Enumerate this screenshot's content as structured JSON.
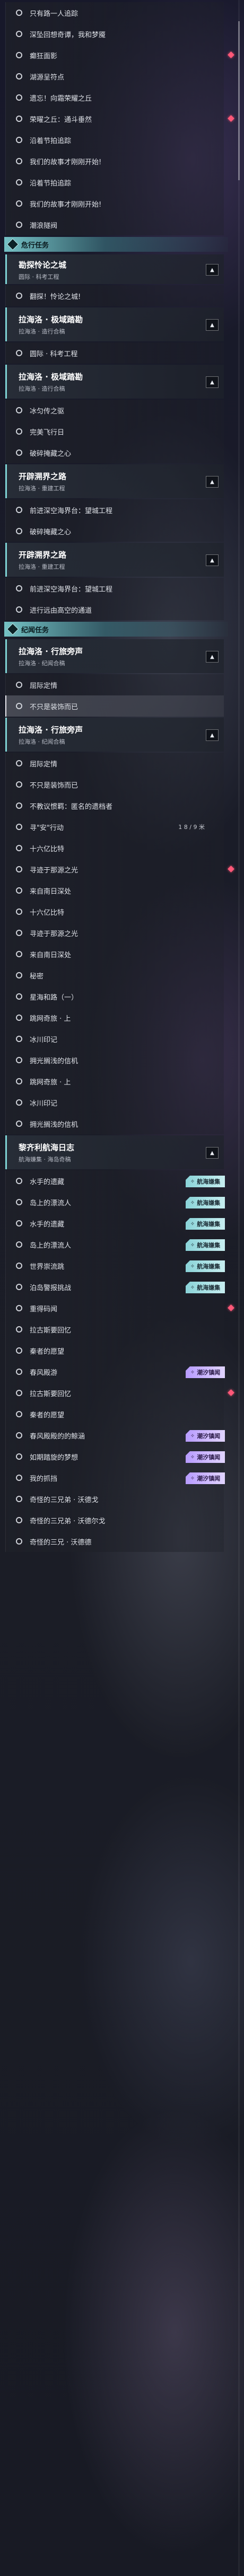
{
  "quest_log": {
    "sections": [
      {
        "label": "危行任务",
        "icon": "quest-diamond-icon"
      },
      {
        "label": "纪闻任务",
        "icon": "lore-quest-diamond-icon"
      }
    ],
    "entries": [
      {
        "kind": "quest",
        "label": "只有路一人追踪",
        "selected": false,
        "new": false
      },
      {
        "kind": "quest",
        "label": "深坠回想奇谭，我和梦魇",
        "selected": false,
        "new": false
      },
      {
        "kind": "quest",
        "label": "癫狂面影",
        "selected": false,
        "new": true
      },
      {
        "kind": "quest",
        "label": "湖源呈符点",
        "selected": false,
        "new": false
      },
      {
        "kind": "quest",
        "label": "遗忘！向霜荣耀之丘",
        "selected": false,
        "new": false
      },
      {
        "kind": "quest",
        "label": "荣曜之丘：通斗垂然",
        "selected": false,
        "new": true
      },
      {
        "kind": "quest",
        "label": "沿着节拍追踪",
        "selected": false,
        "new": false
      },
      {
        "kind": "quest",
        "label": "我们的故事才刚刚开始!",
        "selected": false,
        "new": false
      },
      {
        "kind": "quest",
        "label": "沿着节拍追踪",
        "selected": false,
        "new": false
      },
      {
        "kind": "quest",
        "label": "我们的故事才刚刚开始!",
        "selected": false,
        "new": false
      },
      {
        "kind": "quest",
        "label": "潮浪隧阀",
        "selected": false,
        "new": false
      },
      {
        "kind": "section",
        "section_index": 0
      },
      {
        "kind": "chapter",
        "title": "勘探怜论之城",
        "subtitle": "圆际 · 科考工程"
      },
      {
        "kind": "quest",
        "label": "翻探！怜论之城!",
        "selected": false,
        "new": false
      },
      {
        "kind": "chapter-tall",
        "title": "拉海洛 · 极域踏勘",
        "subtitle": "拉海洛 · 造行合稿"
      },
      {
        "kind": "quest",
        "label": "圆际 · 科考工程",
        "selected": false,
        "new": false
      },
      {
        "kind": "chapter-tall",
        "title": "拉海洛 · 极域踏勘",
        "subtitle": "拉海洛 · 造行合稿"
      },
      {
        "kind": "quest",
        "label": "冰匀传之驱",
        "selected": false,
        "new": false
      },
      {
        "kind": "quest",
        "label": "完美飞行日",
        "selected": false,
        "new": false
      },
      {
        "kind": "quest",
        "label": "破碎掩藏之心",
        "selected": false,
        "new": false
      },
      {
        "kind": "chapter-tall",
        "title": "开辟溯界之路",
        "subtitle": "拉海洛 · 重建工程"
      },
      {
        "kind": "quest",
        "label": "前进深空海界台：望城工程",
        "selected": false,
        "new": false
      },
      {
        "kind": "quest",
        "label": "破碎掩藏之心",
        "selected": false,
        "new": false
      },
      {
        "kind": "chapter-tall",
        "title": "开辟溯界之路",
        "subtitle": "拉海洛 · 重建工程"
      },
      {
        "kind": "quest",
        "label": "前进深空海界台：望城工程",
        "selected": false,
        "new": false
      },
      {
        "kind": "quest",
        "label": "进行远由高空的通道",
        "selected": false,
        "new": false
      },
      {
        "kind": "section",
        "section_index": 1
      },
      {
        "kind": "chapter-tall",
        "title": "拉海洛 · 行旅旁声",
        "subtitle": "拉海洛 · 纪闻合稿"
      },
      {
        "kind": "quest",
        "label": "屈际定情",
        "selected": false,
        "new": false
      },
      {
        "kind": "quest",
        "label": "不只是装饰而已",
        "selected": true,
        "new": false
      },
      {
        "kind": "chapter-tall",
        "title": "拉海洛 · 行旅旁声",
        "subtitle": "拉海洛 · 纪闻合稿"
      },
      {
        "kind": "quest",
        "label": "屈际定情",
        "selected": false,
        "new": false
      },
      {
        "kind": "quest",
        "label": "不只是装饰而已",
        "selected": false,
        "new": false
      },
      {
        "kind": "quest",
        "label": "不教议惯羁：匿名的遗档者",
        "selected": false,
        "new": false
      },
      {
        "kind": "quest",
        "label": "寻\"安\"行动",
        "selected": false,
        "new": false,
        "count": "1 8 / 9 米"
      },
      {
        "kind": "quest",
        "label": "十六亿比特",
        "selected": false,
        "new": false
      },
      {
        "kind": "quest",
        "label": "寻迹于那源之光",
        "selected": false,
        "new": true
      },
      {
        "kind": "quest",
        "label": "来自南日深处",
        "selected": false,
        "new": false
      },
      {
        "kind": "quest",
        "label": "十六亿比特",
        "selected": false,
        "new": false
      },
      {
        "kind": "quest",
        "label": "寻迹于那源之光",
        "selected": false,
        "new": false
      },
      {
        "kind": "quest",
        "label": "来自南日深处",
        "selected": false,
        "new": false
      },
      {
        "kind": "quest",
        "label": "秘密",
        "selected": false,
        "new": false
      },
      {
        "kind": "quest",
        "label": "星海和路（一）",
        "selected": false,
        "new": false
      },
      {
        "kind": "quest",
        "label": "跳网奇旅 · 上",
        "selected": false,
        "new": false
      },
      {
        "kind": "quest",
        "label": "冰川印记",
        "selected": false,
        "new": false
      },
      {
        "kind": "quest",
        "label": "拥光搁浅的信机",
        "selected": false,
        "new": false
      },
      {
        "kind": "quest",
        "label": "跳网奇旅 · 上",
        "selected": false,
        "new": false
      },
      {
        "kind": "quest",
        "label": "冰川印记",
        "selected": false,
        "new": false
      },
      {
        "kind": "quest",
        "label": "拥光搁浅的信机",
        "selected": false,
        "new": false
      },
      {
        "kind": "chapter-tall",
        "title": "黎齐利航海日志",
        "subtitle": "航海嫌集 · 海岛奇稿"
      },
      {
        "kind": "quest",
        "label": "水手的遗藏",
        "selected": false,
        "new": false,
        "tag": {
          "text": "航海嫌集",
          "style": "cyan"
        }
      },
      {
        "kind": "quest",
        "label": "岛上的漂流人",
        "selected": false,
        "new": false,
        "tag": {
          "text": "航海嫌集",
          "style": "cyan"
        }
      },
      {
        "kind": "quest",
        "label": "水手的遗藏",
        "selected": false,
        "new": false,
        "tag": {
          "text": "航海嫌集",
          "style": "cyan"
        }
      },
      {
        "kind": "quest",
        "label": "岛上的漂流人",
        "selected": false,
        "new": false,
        "tag": {
          "text": "航海嫌集",
          "style": "cyan"
        }
      },
      {
        "kind": "quest",
        "label": "世界崇流跳",
        "selected": false,
        "new": false,
        "tag": {
          "text": "航海嫌集",
          "style": "cyan"
        }
      },
      {
        "kind": "quest",
        "label": "泊岛警报挑战",
        "selected": false,
        "new": false,
        "tag": {
          "text": "航海嫌集",
          "style": "cyan"
        }
      },
      {
        "kind": "quest",
        "label": "重得码闻",
        "selected": false,
        "new": true
      },
      {
        "kind": "quest",
        "label": "拉古斯要回忆",
        "selected": false,
        "new": false
      },
      {
        "kind": "quest",
        "label": "秦者的愿望",
        "selected": false,
        "new": false
      },
      {
        "kind": "quest",
        "label": "春风殿游",
        "selected": false,
        "new": false,
        "tag": {
          "text": "潮汐镇闻",
          "style": "purple"
        }
      },
      {
        "kind": "quest",
        "label": "拉古斯要回忆",
        "selected": false,
        "new": true
      },
      {
        "kind": "quest",
        "label": "秦者的愿望",
        "selected": false,
        "new": false
      },
      {
        "kind": "quest",
        "label": "春风殿殿的的鲸涵",
        "selected": false,
        "new": false,
        "tag": {
          "text": "潮汐镇闻",
          "style": "purple"
        }
      },
      {
        "kind": "quest",
        "label": "如期踏旋的梦想",
        "selected": false,
        "new": false,
        "tag": {
          "text": "潮汐镇闻",
          "style": "purple"
        }
      },
      {
        "kind": "quest",
        "label": "我的抓挡",
        "selected": false,
        "new": false,
        "tag": {
          "text": "潮汐镇闻",
          "style": "purple"
        }
      },
      {
        "kind": "quest",
        "label": "奇怪的三兄弟 · 沃德戈",
        "selected": false,
        "new": false
      },
      {
        "kind": "quest",
        "label": "奇怪的三兄弟 · 沃德尔戈",
        "selected": false,
        "new": false
      },
      {
        "kind": "quest",
        "label": "奇怪的三兄 · 沃德德",
        "selected": false,
        "new": false
      }
    ]
  },
  "colors": {
    "accent": "#7fd4d6",
    "new_marker": "#ff5878",
    "tag_cyan": "#8ad3d8",
    "tag_purple": "#b79bff"
  }
}
